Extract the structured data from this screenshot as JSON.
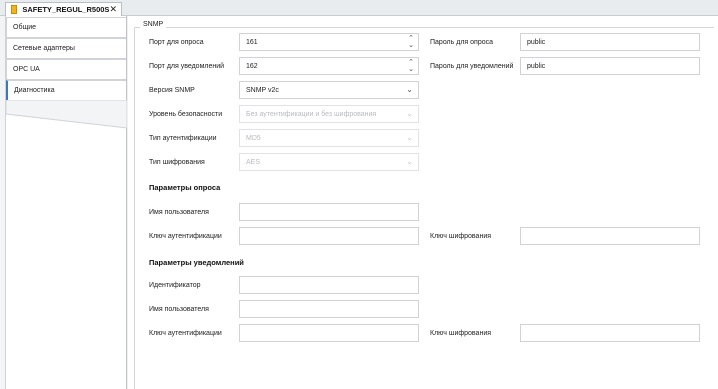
{
  "tab": {
    "title": "SAFETY_REGUL_R500S",
    "close": "✕"
  },
  "nav": {
    "items": [
      "Общие",
      "Сетевые адаптеры",
      "OPC UA",
      "Диагностика"
    ]
  },
  "snmp": {
    "legend": "SNMP",
    "poll_port_label": "Порт для опроса",
    "poll_port_value": "161",
    "notify_port_label": "Порт для уведомлений",
    "notify_port_value": "162",
    "poll_password_label": "Пароль для опроса",
    "poll_password_value": "public",
    "notify_password_label": "Пароль для уведомлений",
    "notify_password_value": "public",
    "version_label": "Версия SNMP",
    "version_value": "SNMP v2c",
    "security_label": "Уровень безопасности",
    "security_value": "Без аутентификации и без шифрования",
    "auth_type_label": "Тип аутентификации",
    "auth_type_value": "MD5",
    "cipher_type_label": "Тип шифрования",
    "cipher_type_value": "AES"
  },
  "poll_params": {
    "header": "Параметры опроса",
    "username_label": "Имя пользователя",
    "username_value": "",
    "auth_key_label": "Ключ аутентификации",
    "auth_key_value": "",
    "cipher_key_label": "Ключ шифрования",
    "cipher_key_value": ""
  },
  "notify_params": {
    "header": "Параметры уведомлений",
    "identifier_label": "Идентификатор",
    "identifier_value": "",
    "username_label": "Имя пользователя",
    "username_value": "",
    "auth_key_label": "Ключ аутентификации",
    "auth_key_value": "",
    "cipher_key_label": "Ключ шифрования",
    "cipher_key_value": ""
  }
}
